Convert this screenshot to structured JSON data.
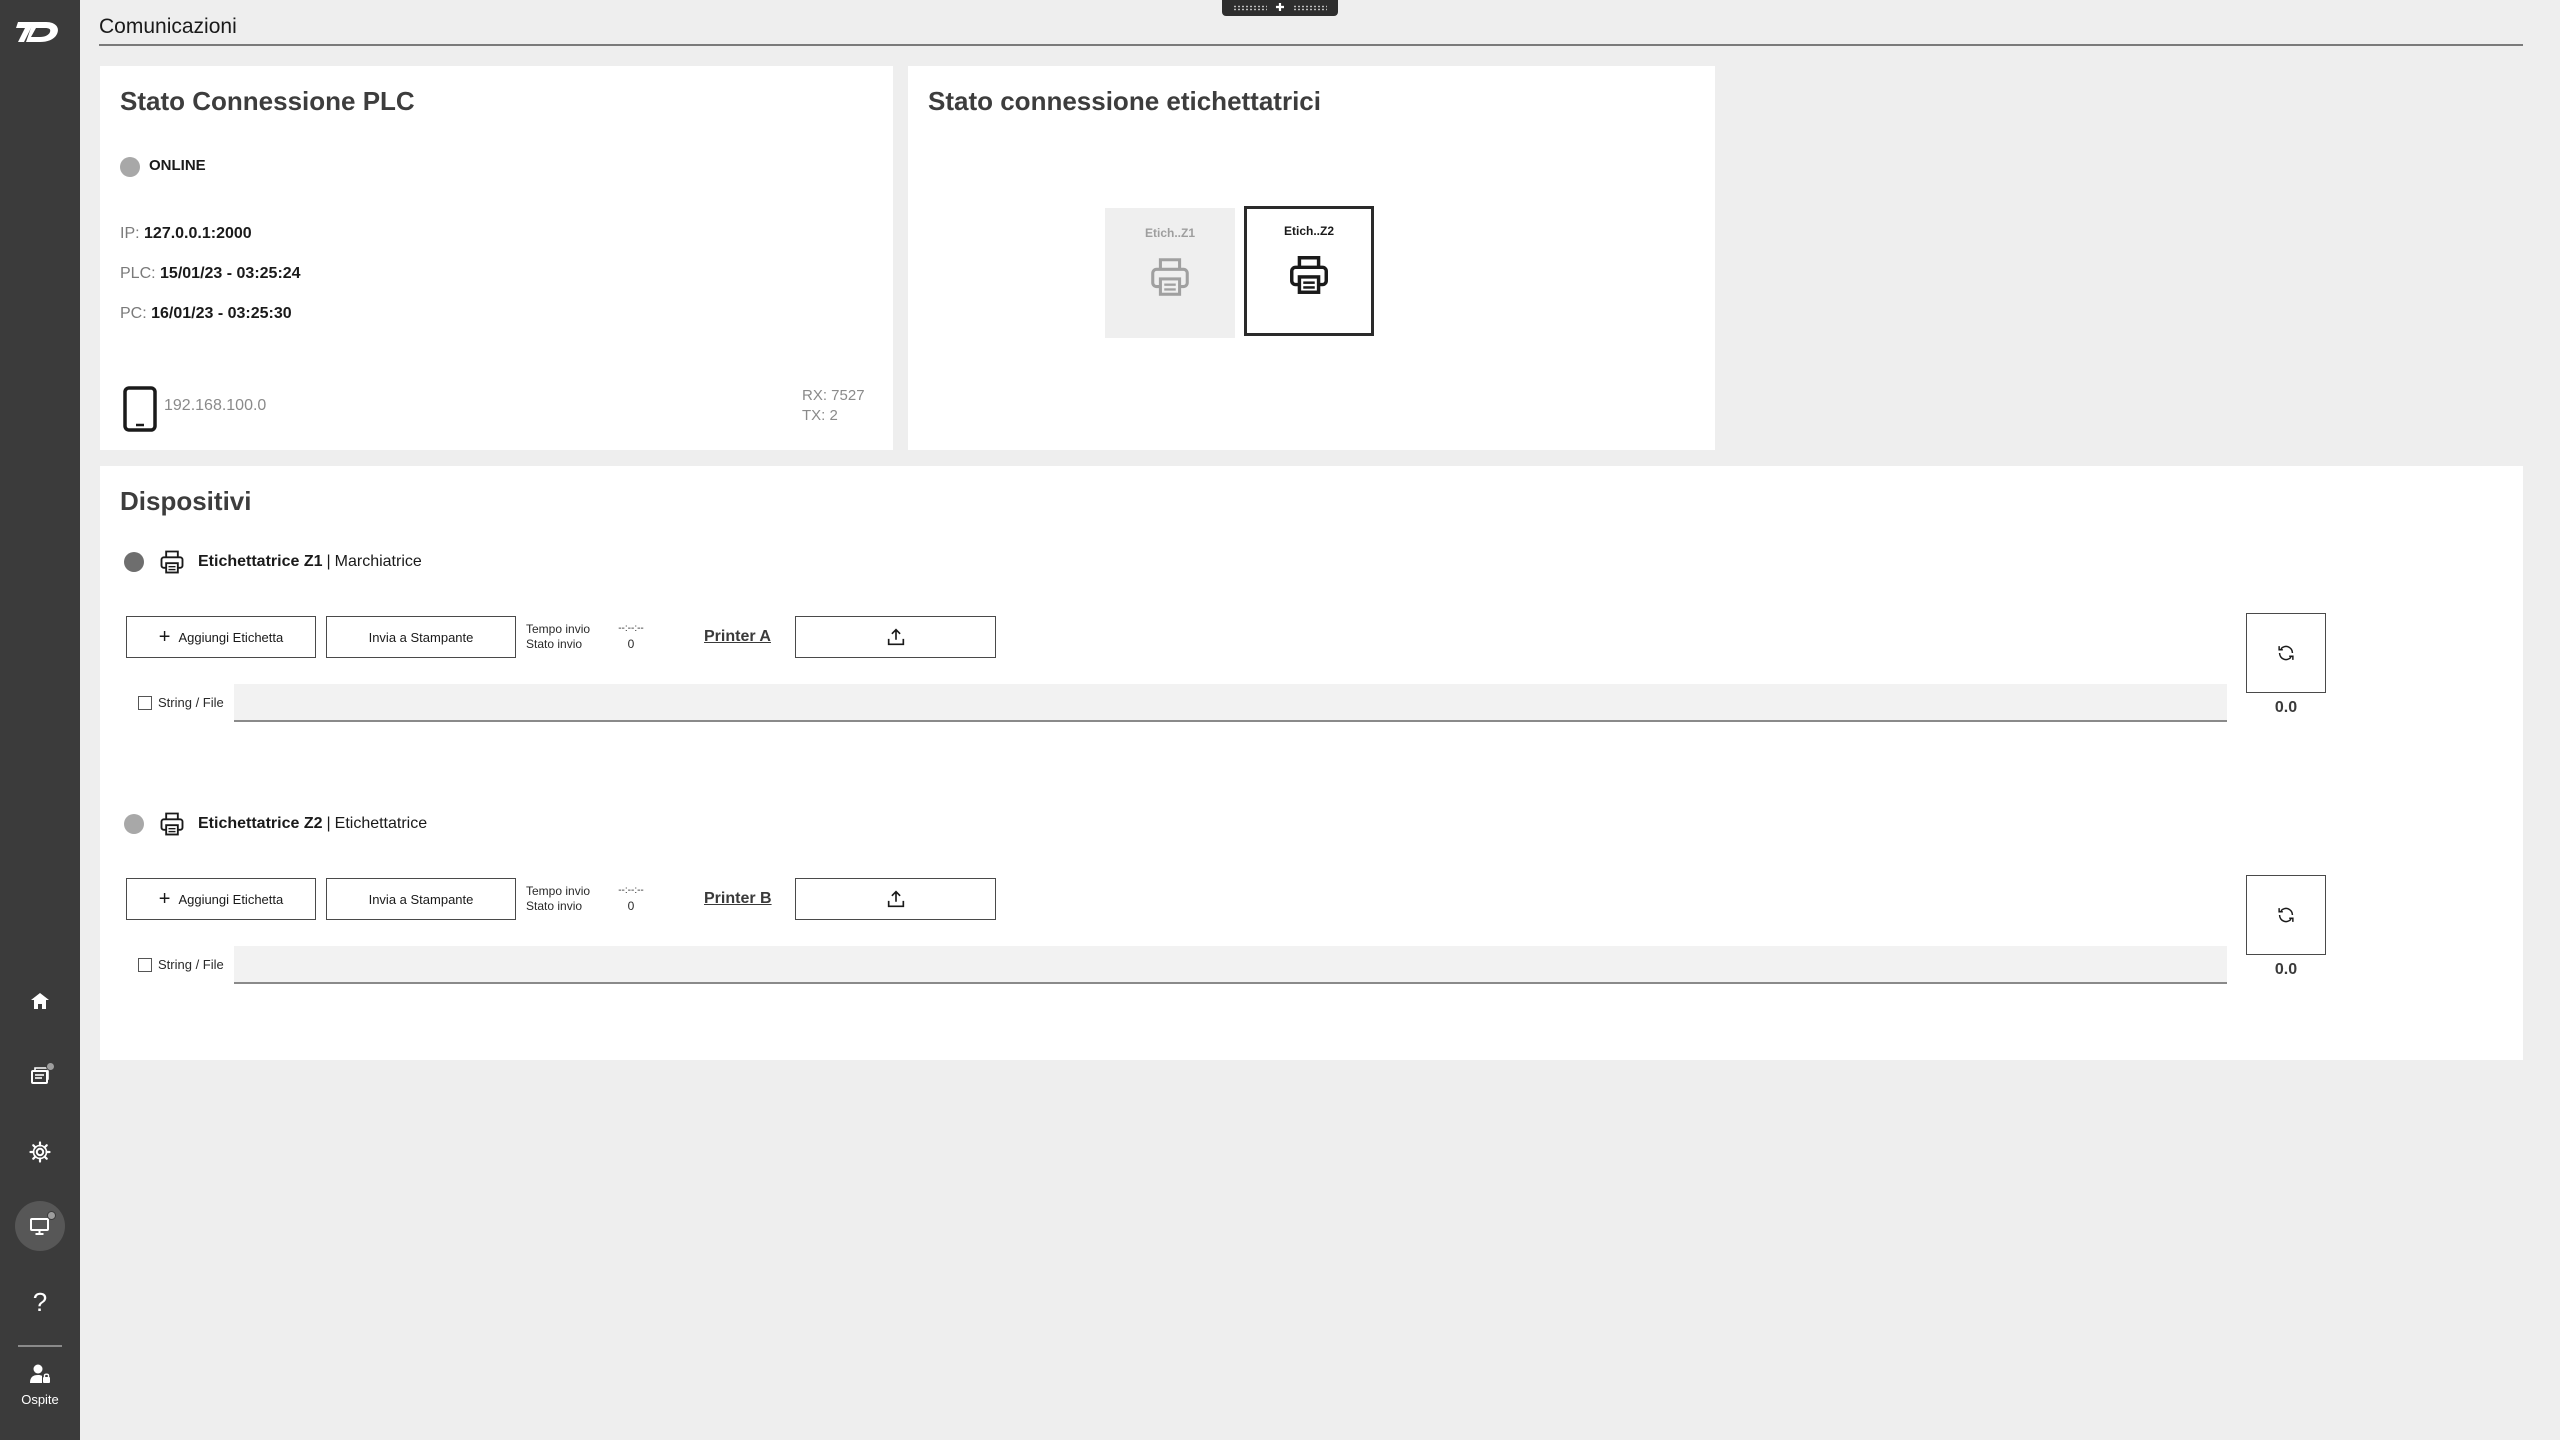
{
  "app": {
    "page_title": "Comunicazioni",
    "user_label": "Ospite"
  },
  "colors": {
    "sidebar_bg": "#3b3b3b",
    "card_bg": "#ffffff",
    "page_bg": "#eeeeee",
    "status_online": "#a8a8a8",
    "device_z1_status": "#6e6e6e",
    "device_z2_status": "#a8a8a8"
  },
  "sidebar": {
    "items": [
      {
        "icon": "home-icon"
      },
      {
        "icon": "labels-icon",
        "badge": true
      },
      {
        "icon": "gear-icon"
      },
      {
        "icon": "monitor-icon",
        "badge": true,
        "active": true
      },
      {
        "icon": "help-icon",
        "glyph": "?"
      }
    ]
  },
  "plc": {
    "title": "Stato Connessione PLC",
    "status": "ONLINE",
    "ip_label": "IP:",
    "ip_value": "127.0.0.1:2000",
    "plc_label": "PLC:",
    "plc_value": "15/01/23 - 03:25:24",
    "pc_label": "PC:",
    "pc_value": "16/01/23 - 03:25:30",
    "device_ip": "192.168.100.0",
    "rx": "RX: 7527",
    "tx": "TX: 2"
  },
  "labelers": {
    "title": "Stato connessione etichettatrici",
    "tiles": [
      {
        "label": "Etich..Z1",
        "active": false
      },
      {
        "label": "Etich..Z2",
        "active": true
      }
    ]
  },
  "devices": {
    "title": "Dispositivi",
    "list": [
      {
        "name": "Etichettatrice Z1",
        "separator": "|",
        "type": "Marchiatrice",
        "add_label": "Aggiungi Etichetta",
        "send_label": "Invia a Stampante",
        "send_time_label": "Tempo invio",
        "send_state_label": "Stato invio",
        "send_time_value": "--:--:--",
        "send_state_value": "0",
        "printer": "Printer A",
        "checkbox_label": "String / File",
        "field_value": "",
        "refresh_value": "0.0"
      },
      {
        "name": "Etichettatrice Z2",
        "separator": "|",
        "type": "Etichettatrice",
        "add_label": "Aggiungi Etichetta",
        "send_label": "Invia a Stampante",
        "send_time_label": "Tempo invio",
        "send_state_label": "Stato invio",
        "send_time_value": "--:--:--",
        "send_state_value": "0",
        "printer": "Printer B",
        "checkbox_label": "String / File",
        "field_value": "",
        "refresh_value": "0.0"
      }
    ]
  }
}
